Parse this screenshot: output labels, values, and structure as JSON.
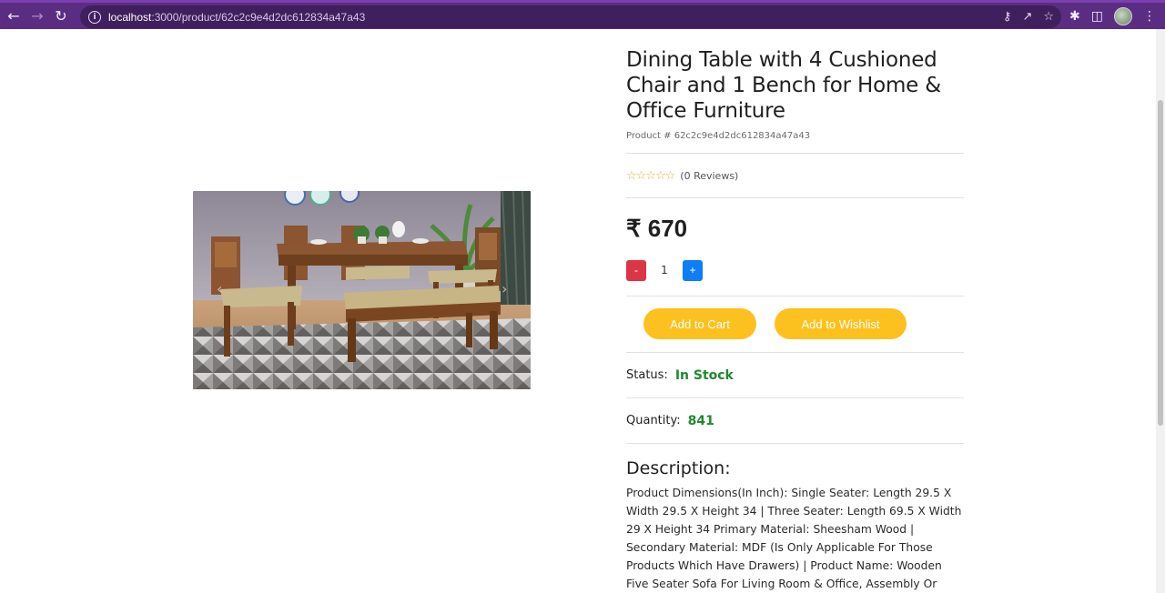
{
  "browser": {
    "url_host": "localhost",
    "url_rest": ":3000/product/62c2c9e4d2dc612834a47a43"
  },
  "product": {
    "title": "Dining Table with 4 Cushioned Chair and 1 Bench for Home & Office Furniture",
    "id_text": "Product # 62c2c9e4d2dc612834a47a43",
    "stars": "☆☆☆☆☆",
    "reviews": "(0 Reviews)",
    "price": "₹ 670",
    "quantity_selected": "1",
    "minus_label": "-",
    "plus_label": "+",
    "add_to_cart": "Add to Cart",
    "add_to_wishlist": "Add to Wishlist",
    "status_label": "Status:",
    "status_value": "In Stock",
    "stock_label": "Quantity:",
    "stock_value": "841",
    "description_heading": "Description:",
    "description_text": "Product Dimensions(In Inch): Single Seater: Length 29.5 X Width 29.5 X Height 34 | Three Seater: Length 69.5 X Width 29 X Height 34 Primary Material: Sheesham Wood | Secondary Material: MDF (Is Only Applicable For Those Products Which Have Drawers) | Product Name: Wooden Five Seater Sofa For Living Room & Office, Assembly Or"
  },
  "colors": {
    "chrome": "#5a2d82",
    "accent_yellow": "#fcc11f",
    "in_stock_green": "#1e8a2f",
    "minus_red": "#dc3545",
    "plus_blue": "#0d7ef5"
  }
}
